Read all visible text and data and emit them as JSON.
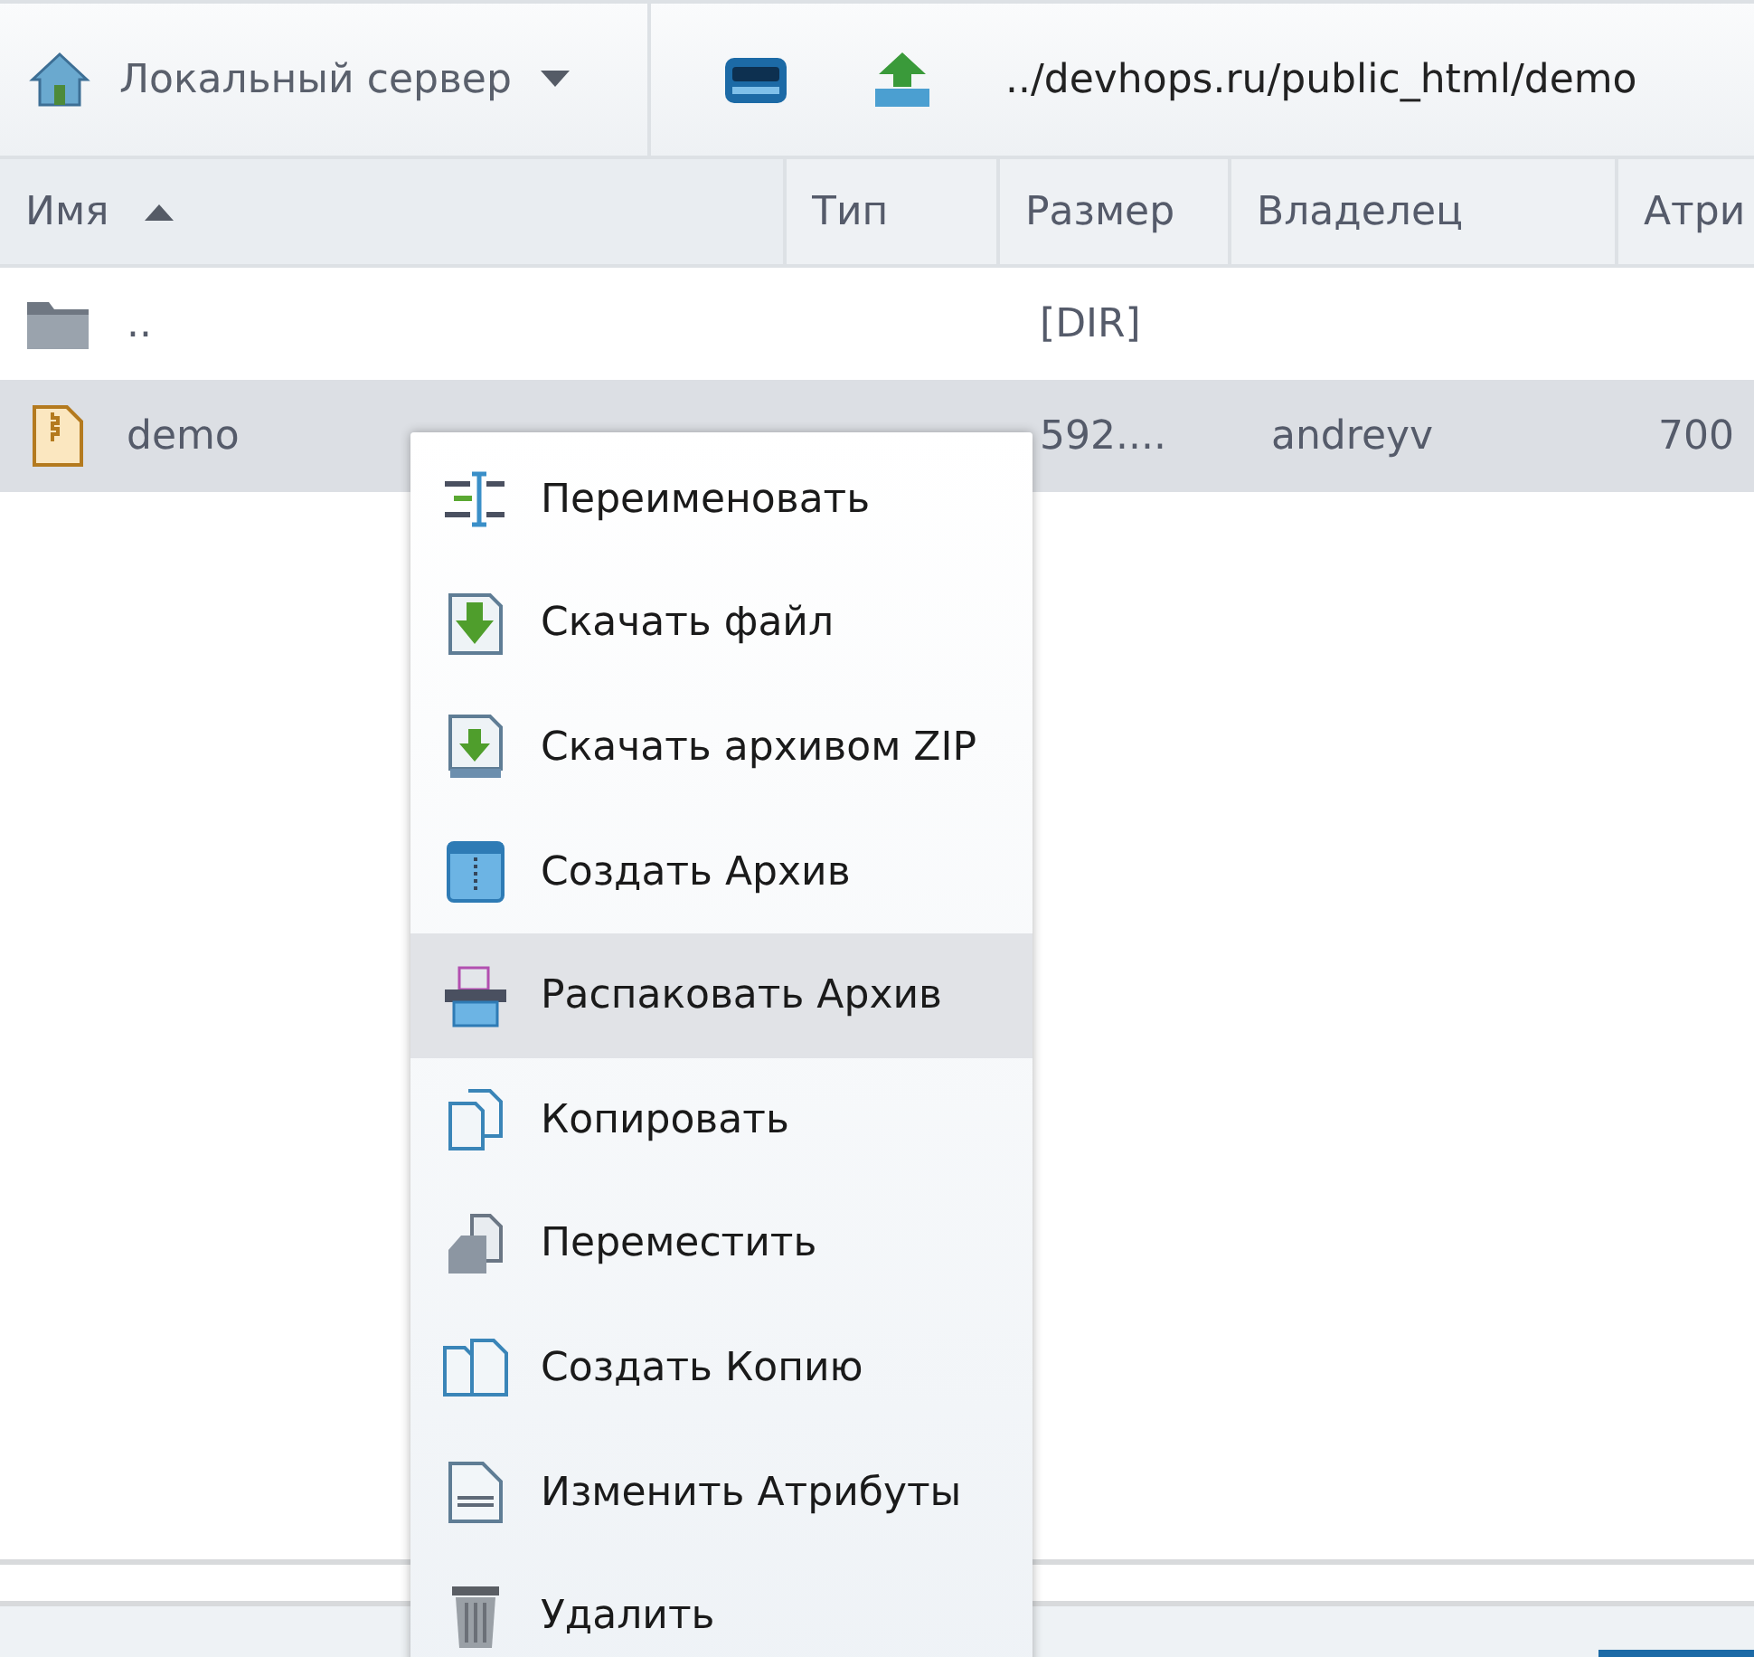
{
  "toolbar": {
    "server": "Локальный сервер",
    "path": "../devhops.ru/public_html/demo"
  },
  "table": {
    "columns": [
      {
        "label": "Имя",
        "sorted": true
      },
      {
        "label": "Тип",
        "sorted": false
      },
      {
        "label": "Размер",
        "sorted": false
      },
      {
        "label": "Владелец",
        "sorted": false
      },
      {
        "label": "Атри",
        "sorted": false
      }
    ],
    "rows": [
      {
        "kind": "folder",
        "name": "..",
        "type": "",
        "size": "[DIR]",
        "owner": "",
        "attrs": "",
        "selected": false
      },
      {
        "kind": "zip",
        "name": "demo",
        "type": "",
        "size": "592....",
        "owner": "andreyv",
        "attrs": "700",
        "selected": true
      }
    ]
  },
  "context_menu": {
    "items": [
      {
        "kind": "rename",
        "label": "Переименовать",
        "selected": false
      },
      {
        "kind": "download",
        "label": "Скачать файл",
        "selected": false
      },
      {
        "kind": "download-zip",
        "label": "Скачать архивом ZIP",
        "selected": false
      },
      {
        "kind": "archive",
        "label": "Создать Архив",
        "selected": false
      },
      {
        "kind": "extract",
        "label": "Распаковать Архив",
        "selected": true
      },
      {
        "kind": "copy",
        "label": "Копировать",
        "selected": false
      },
      {
        "kind": "move",
        "label": "Переместить",
        "selected": false
      },
      {
        "kind": "duplicate",
        "label": "Создать Копию",
        "selected": false
      },
      {
        "kind": "chmod",
        "label": "Изменить Атрибуты",
        "selected": false
      },
      {
        "kind": "delete",
        "label": "Удалить",
        "selected": false
      }
    ]
  }
}
